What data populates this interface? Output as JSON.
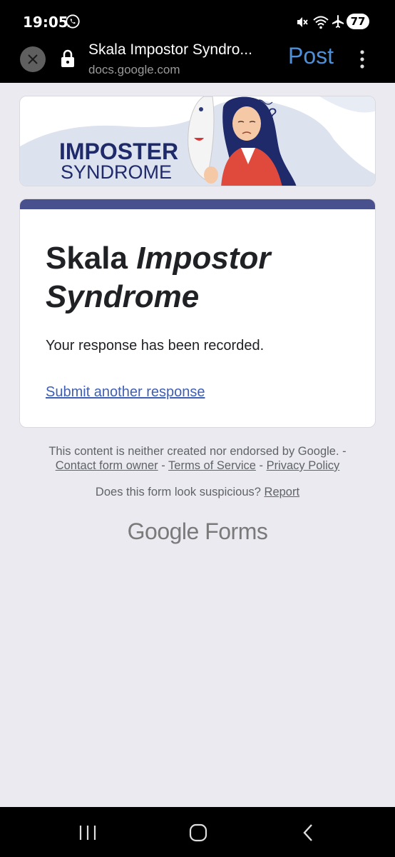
{
  "status_bar": {
    "time": "19:05",
    "battery": "77",
    "icons": [
      "whatsapp-icon",
      "mute-icon",
      "wifi-icon",
      "airplane-icon",
      "battery-icon"
    ]
  },
  "browser": {
    "title": "Skala Impostor Syndro...",
    "url": "docs.google.com",
    "action_label": "Post",
    "icons": [
      "close-icon",
      "lock-icon",
      "more-vert-icon"
    ]
  },
  "banner": {
    "line1": "IMPOSTER",
    "line2": "SYNDROME"
  },
  "form": {
    "title_plain": "Skala ",
    "title_italic_1": "Impostor",
    "title_italic_2": "Syndrome",
    "message": "Your response has been recorded.",
    "again_link": "Submit another response",
    "accent_color": "#48508e"
  },
  "footer": {
    "disclaimer": "This content is neither created nor endorsed by Google. -",
    "contact": "Contact form owner",
    "sep1": " - ",
    "terms": "Terms of Service",
    "sep2": " - ",
    "privacy": "Privacy Policy",
    "suspicious": "Does this form look suspicious? ",
    "report": "Report",
    "logo_google": "Google",
    "logo_forms": "Forms"
  },
  "nav": {
    "icons": [
      "recents-icon",
      "home-icon",
      "back-icon"
    ]
  }
}
